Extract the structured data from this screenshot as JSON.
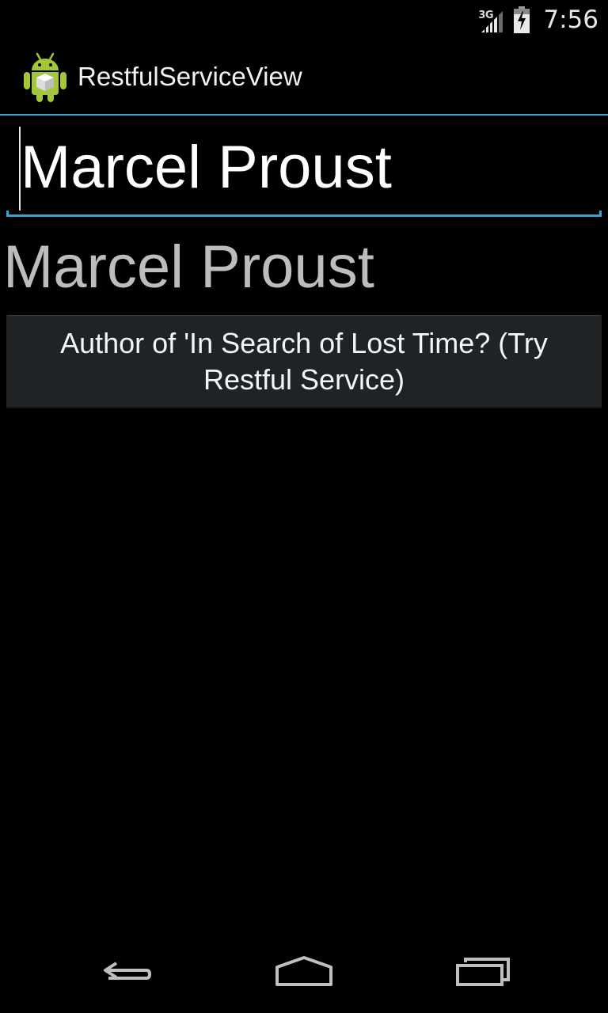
{
  "status_bar": {
    "network_type": "3G",
    "time": "7:56",
    "icons": [
      "signal-icon",
      "battery-charging-icon"
    ]
  },
  "action_bar": {
    "title": "RestfulServiceView",
    "app_icon": "android-app-icon"
  },
  "edit_field": {
    "value": "Marcel Proust"
  },
  "result_text": "Marcel Proust",
  "action_button": {
    "label": "Author of 'In Search of Lost Time? (Try Restful Service)"
  },
  "nav_bar": {
    "icons": [
      "back-icon",
      "home-icon",
      "recents-icon"
    ]
  },
  "colors": {
    "accent": "#33a3d6",
    "background": "#000000",
    "button": "#1f2326"
  }
}
